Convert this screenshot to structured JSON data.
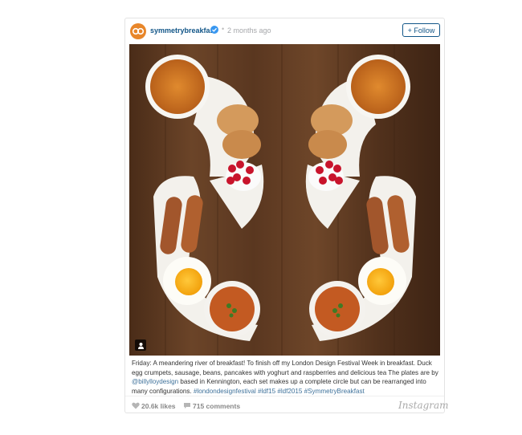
{
  "post": {
    "username": "symmetrybreakfast",
    "separator": "•",
    "time": "2 months ago",
    "follow_label": "+ Follow",
    "caption_main": "Friday: A meandering river of breakfast! To finish off my London Design Festival Week in breakfast. Duck egg crumpets, sausage, beans, pancakes with yoghurt and raspberries and delicious tea The plates are by ",
    "mention": "@billylloydesign",
    "caption_tail": " based in Kennington, each set makes up a complete circle but can be rearranged into many configurations. ",
    "hashtags": "#londondesignfestival #ldf15 #ldf2015 #SymmetryBreakfast",
    "likes": "20.6k likes",
    "comments": "715 comments",
    "brand": "Instagram"
  },
  "icons": {
    "avatar": "avatar-logo-icon",
    "verified": "verified-badge-icon",
    "user_tag": "user-tag-icon",
    "likes": "heart-icon",
    "comments": "speech-bubble-icon"
  },
  "colors": {
    "link": "#125688",
    "hashtag": "#3f729b",
    "verified": "#3897f0",
    "avatar": "#e8862a"
  }
}
